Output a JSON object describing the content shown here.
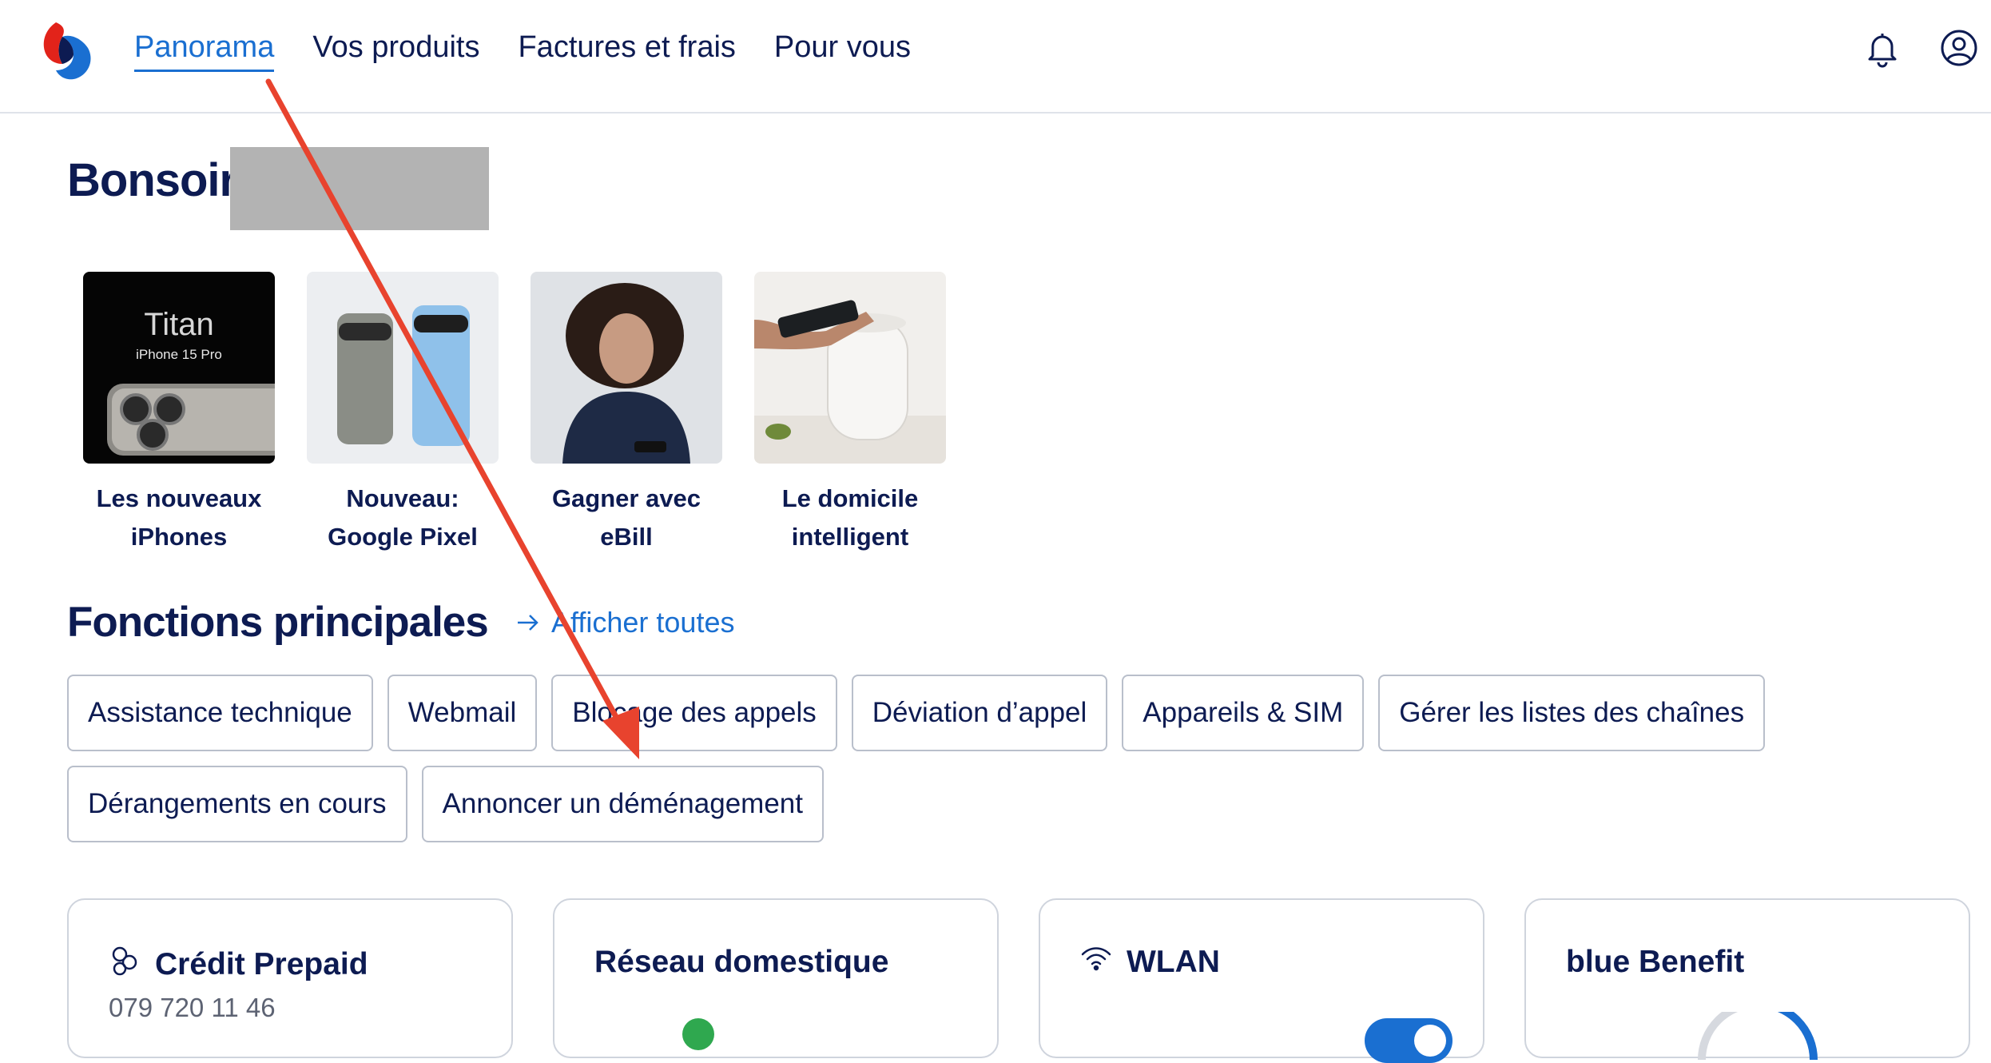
{
  "nav": {
    "items": [
      {
        "label": "Panorama",
        "active": true
      },
      {
        "label": "Vos produits",
        "active": false
      },
      {
        "label": "Factures et frais",
        "active": false
      },
      {
        "label": "Pour vous",
        "active": false
      }
    ],
    "icons": [
      "bell-icon",
      "user-account-icon"
    ]
  },
  "greeting": {
    "text": "Bonsoir"
  },
  "promos": [
    {
      "caption": "Les nouveaux iPhones",
      "image_text": "Titan",
      "image_subtext": "iPhone 15 Pro"
    },
    {
      "caption": "Nouveau: Google Pixel"
    },
    {
      "caption": "Gagner avec eBill"
    },
    {
      "caption": "Le domicile intelligent"
    }
  ],
  "functions": {
    "title": "Fonctions principales",
    "show_all": "Afficher toutes",
    "chips_row1": [
      "Assistance technique",
      "Webmail",
      "Blocage des appels",
      "Déviation d’appel",
      "Appareils & SIM",
      "Gérer les listes des chaînes"
    ],
    "chips_row2": [
      "Dérangements en cours",
      "Annoncer un déménagement"
    ]
  },
  "cards": [
    {
      "title": "Crédit Prepaid",
      "subtitle": "079 720 11 46",
      "icon": "coins-icon"
    },
    {
      "title": "Réseau domestique"
    },
    {
      "title": "WLAN",
      "icon": "wifi-icon"
    },
    {
      "title": "blue Benefit"
    }
  ],
  "colors": {
    "brand": "#0d1b52",
    "accent": "#1a6fd1",
    "annotation": "#e8432e"
  }
}
